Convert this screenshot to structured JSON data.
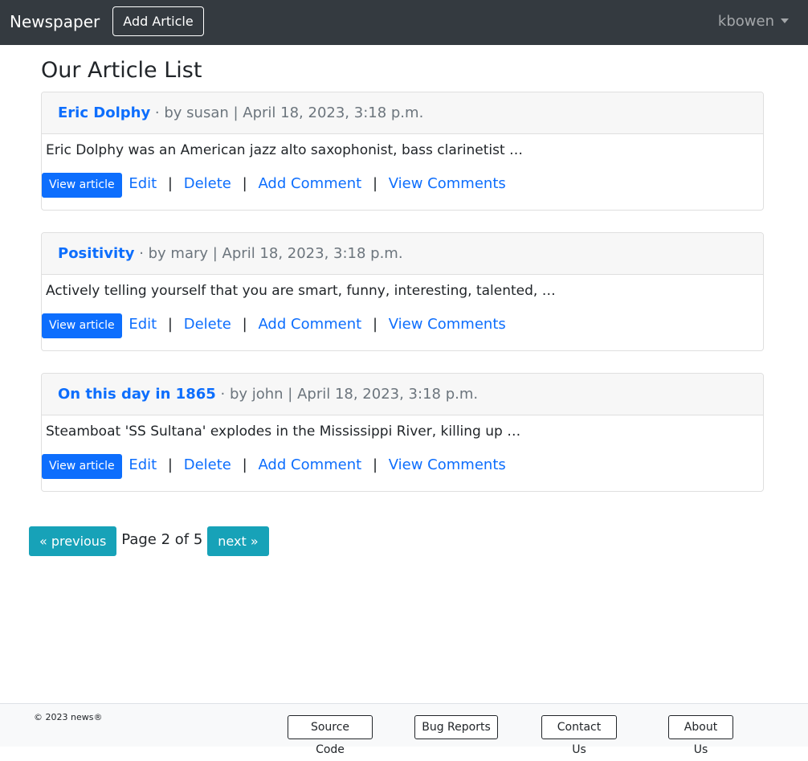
{
  "navbar": {
    "brand": "Newspaper",
    "add_article": "Add Article",
    "user": "kbowen"
  },
  "main": {
    "title": "Our Article List",
    "articles": [
      {
        "title": "Eric Dolphy",
        "meta": " · by susan | April 18, 2023, 3:18 p.m.",
        "summary": "Eric Dolphy was an American jazz alto saxophonist, bass clarinetist …"
      },
      {
        "title": "Positivity",
        "meta": " · by mary | April 18, 2023, 3:18 p.m.",
        "summary": "Actively telling yourself that you are smart, funny, interesting, talented, …"
      },
      {
        "title": "On this day in 1865",
        "meta": " · by john | April 18, 2023, 3:18 p.m.",
        "summary": "Steamboat 'SS Sultana' explodes in the Mississippi River, killing up …"
      }
    ],
    "actions": {
      "view": "View article",
      "edit": "Edit",
      "delete": "Delete",
      "add_comment": "Add Comment",
      "view_comments": "View Comments",
      "separator": "|"
    }
  },
  "pagination": {
    "previous": "« previous",
    "info": "Page 2 of 5",
    "next": "next »"
  },
  "footer": {
    "copyright": "© 2023 news®",
    "links": [
      "Source Code",
      "Bug Reports",
      "Contact Us",
      "About Us"
    ]
  },
  "colors": {
    "navbar": "#343a40",
    "link": "#0d6efd",
    "pager": "#17a2b8"
  }
}
